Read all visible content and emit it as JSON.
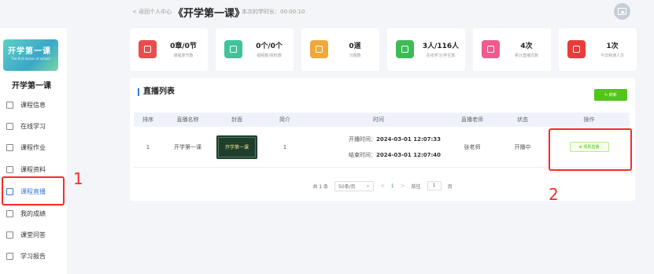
{
  "header": {
    "back_link": "< 返回个人中心",
    "course_title": "《开学第一课》",
    "study_time": "本次的学时长：00:00:10"
  },
  "sidebar": {
    "cover_title": "开学第一课",
    "cover_subtitle": "The first lesson of school",
    "course_name": "开学第一课",
    "items": [
      {
        "label": "课程信息"
      },
      {
        "label": "在线学习"
      },
      {
        "label": "课程作业"
      },
      {
        "label": "课程资料"
      },
      {
        "label": "课程直播"
      },
      {
        "label": "我的成绩"
      },
      {
        "label": "课堂问答"
      },
      {
        "label": "学习报告"
      }
    ],
    "active_index": 4
  },
  "stats": [
    {
      "value": "0章/0节",
      "label": "课程章节数",
      "color": "#e84c4c"
    },
    {
      "value": "0个/0个",
      "label": "视频数/资料数",
      "color": "#3ec39a"
    },
    {
      "value": "0道",
      "label": "习题数",
      "color": "#f0a83a"
    },
    {
      "value": "3人/116人",
      "label": "在线学习/学生数",
      "color": "#3dbb56"
    },
    {
      "value": "4次",
      "label": "累计直播次数",
      "color": "#ef5b8c"
    },
    {
      "value": "1次",
      "label": "今日到课人次",
      "color": "#e63c3c"
    }
  ],
  "live_panel": {
    "title": "直播列表",
    "refresh_label": "↻ 刷新",
    "columns": [
      "排序",
      "直播名称",
      "封面",
      "简介",
      "时间",
      "直播老师",
      "状态",
      "操作"
    ],
    "rows": [
      {
        "order": "1",
        "name": "开学第一课",
        "cover_text": "开学第一课",
        "intro": "1",
        "start_label": "开播时间：",
        "start_time": "2024-03-01 12:07:33",
        "end_label": "结束时间：",
        "end_time": "2024-03-01 12:07:40",
        "teacher": "张老师",
        "status": "开播中",
        "action_label": "⊕ 观看直播"
      }
    ],
    "pagination": {
      "total": "共 1 条",
      "page_size": "50条/页",
      "prev": "<",
      "current": "1",
      "next": ">",
      "goto_label": "前往",
      "goto_value": "1",
      "page_unit": "页"
    }
  },
  "annotations": {
    "marker_1": "1",
    "marker_2": "2",
    "highlight_color": "#ff2a2a"
  }
}
